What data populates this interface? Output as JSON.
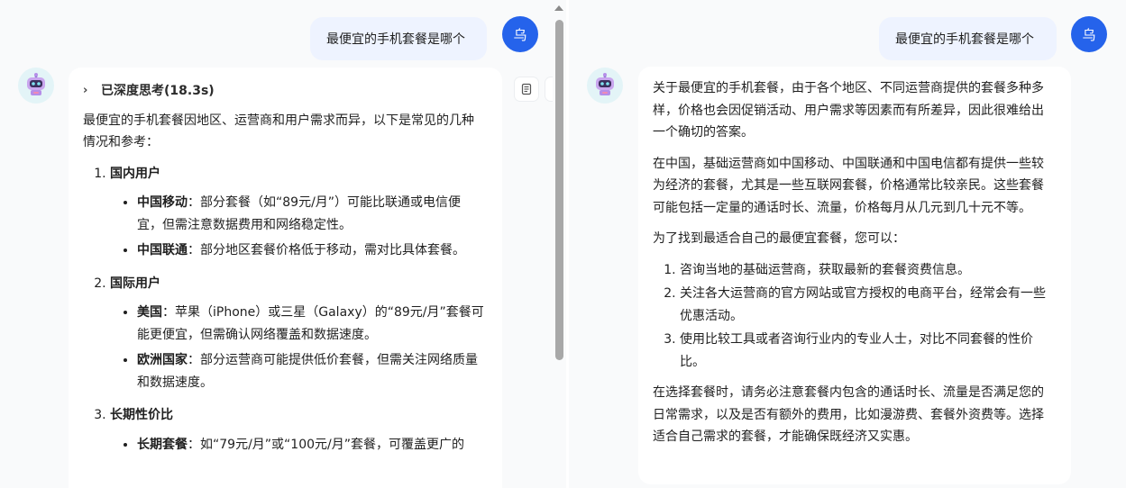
{
  "left": {
    "user_message": "最便宜的手机套餐是哪个",
    "user_avatar_label": "乌",
    "thinking_label": "已深度思考(18.3s)",
    "intro": "最便宜的手机套餐因地区、运营商和用户需求而异，以下是常见的几种情况和参考：",
    "sections": [
      {
        "heading": "国内用户",
        "items": [
          {
            "bold": "中国移动",
            "text": "：部分套餐（如“89元/月”）可能比联通或电信便宜，但需注意数据费用和网络稳定性。"
          },
          {
            "bold": "中国联通",
            "text": "：部分地区套餐价格低于移动，需对比具体套餐。"
          }
        ]
      },
      {
        "heading": "国际用户",
        "items": [
          {
            "bold": "美国",
            "text": "：苹果（iPhone）或三星（Galaxy）的“89元/月”套餐可能更便宜，但需确认网络覆盖和数据速度。"
          },
          {
            "bold": "欧洲国家",
            "text": "：部分运营商可能提供低价套餐，但需关注网络质量和数据速度。"
          }
        ]
      },
      {
        "heading": "长期性价比",
        "items": [
          {
            "bold": "长期套餐",
            "text": "：如“79元/月”或“100元/月”套餐，可覆盖更广的"
          }
        ]
      }
    ]
  },
  "right": {
    "user_message": "最便宜的手机套餐是哪个",
    "user_avatar_label": "乌",
    "paragraphs": [
      "关于最便宜的手机套餐，由于各个地区、不同运营商提供的套餐多种多样，价格也会因促销活动、用户需求等因素而有所差异，因此很难给出一个确切的答案。",
      "在中国，基础运营商如中国移动、中国联通和中国电信都有提供一些较为经济的套餐，尤其是一些互联网套餐，价格通常比较亲民。这些套餐可能包括一定量的通话时长、流量，价格每月从几元到几十元不等。",
      "为了找到最适合自己的最便宜套餐，您可以："
    ],
    "steps": [
      "咨询当地的基础运营商，获取最新的套餐资费信息。",
      "关注各大运营商的官方网站或官方授权的电商平台，经常会有一些优惠活动。",
      "使用比较工具或者咨询行业内的专业人士，对比不同套餐的性价比。"
    ],
    "closing": "在选择套餐时，请务必注意套餐内包含的通话时长、流量是否满足您的日常需求，以及是否有额外的费用，比如漫游费、套餐外资费等。选择适合自己需求的套餐，才能确保既经济又实惠。"
  },
  "colors": {
    "user_bubble": "#eef3ff",
    "user_avatar": "#2563eb",
    "bot_avatar_bg": "#e3f4f7",
    "pane_bg": "#f9fafb"
  },
  "icons": {
    "bot_avatar": "robot-icon",
    "thinking_toggle": "chevron-right-icon",
    "side_action": "document-icon"
  }
}
